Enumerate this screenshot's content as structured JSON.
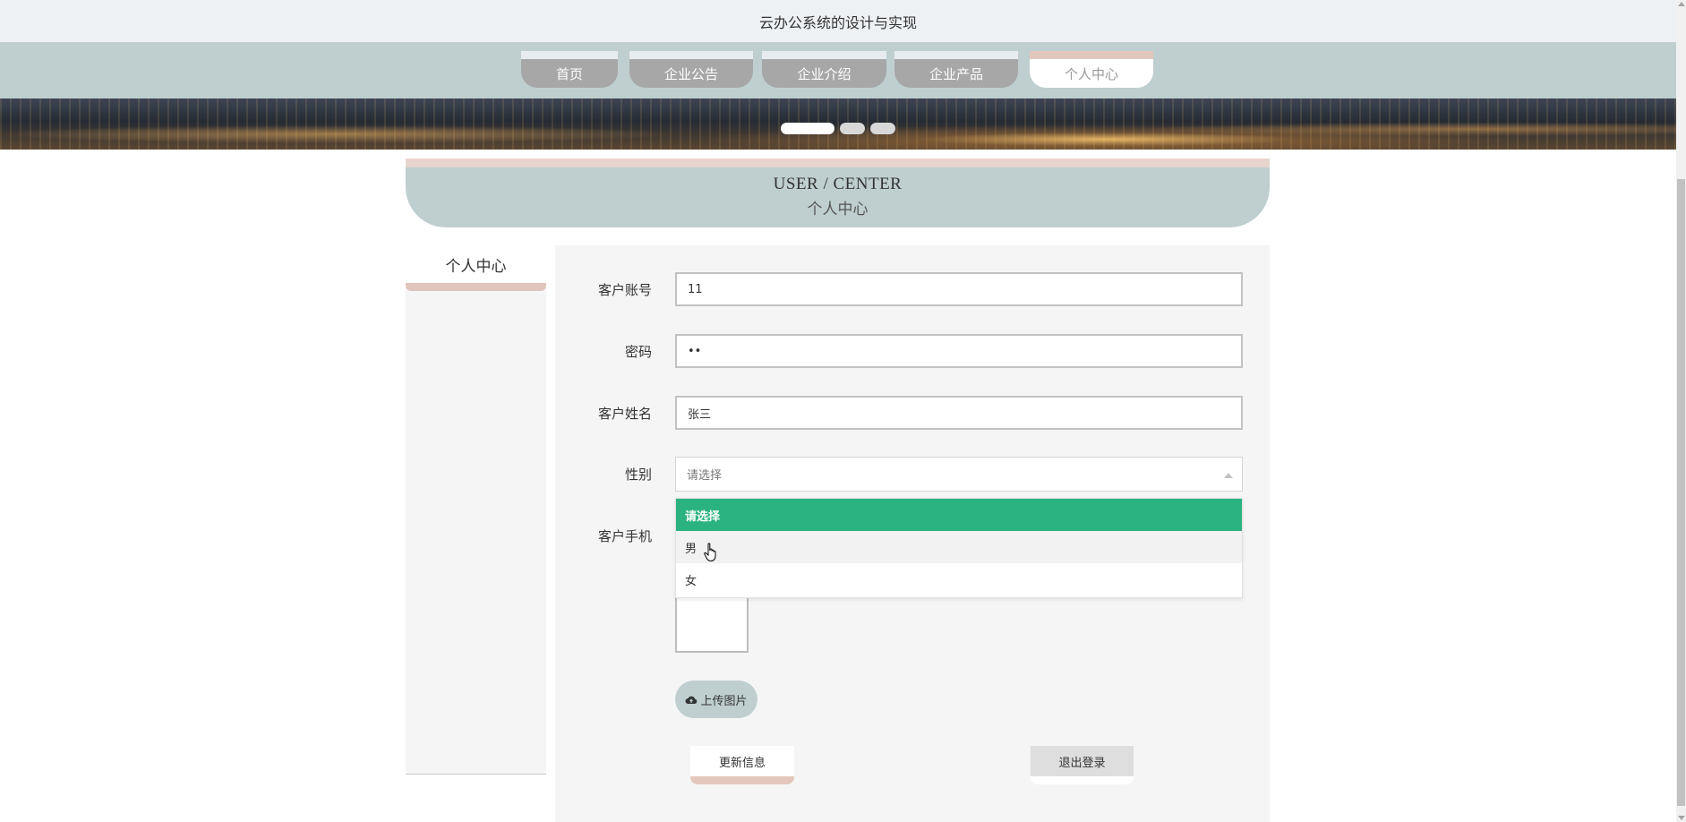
{
  "header": {
    "title": "云办公系统的设计与实现"
  },
  "nav": {
    "tabs": [
      {
        "label": "首页"
      },
      {
        "label": "企业公告"
      },
      {
        "label": "企业介绍"
      },
      {
        "label": "企业产品"
      },
      {
        "label": "个人中心",
        "active": true
      }
    ]
  },
  "section": {
    "title_en": "USER / CENTER",
    "title_cn": "个人中心"
  },
  "sidebar": {
    "title": "个人中心"
  },
  "form": {
    "account_label": "客户账号",
    "account_value": "11",
    "password_label": "密码",
    "password_value": "••",
    "name_label": "客户姓名",
    "name_value": "张三",
    "gender_label": "性别",
    "gender_placeholder": "请选择",
    "gender_options": [
      "请选择",
      "男",
      "女"
    ],
    "phone_label": "客户手机",
    "upload_label": "上传图片",
    "update_button": "更新信息",
    "logout_button": "退出登录"
  },
  "colors": {
    "accent_green": "#2bb281",
    "nav_bg": "#bfcfd0",
    "tab_gray": "#a7a7a7",
    "accent_pink": "#e4c7bc"
  }
}
